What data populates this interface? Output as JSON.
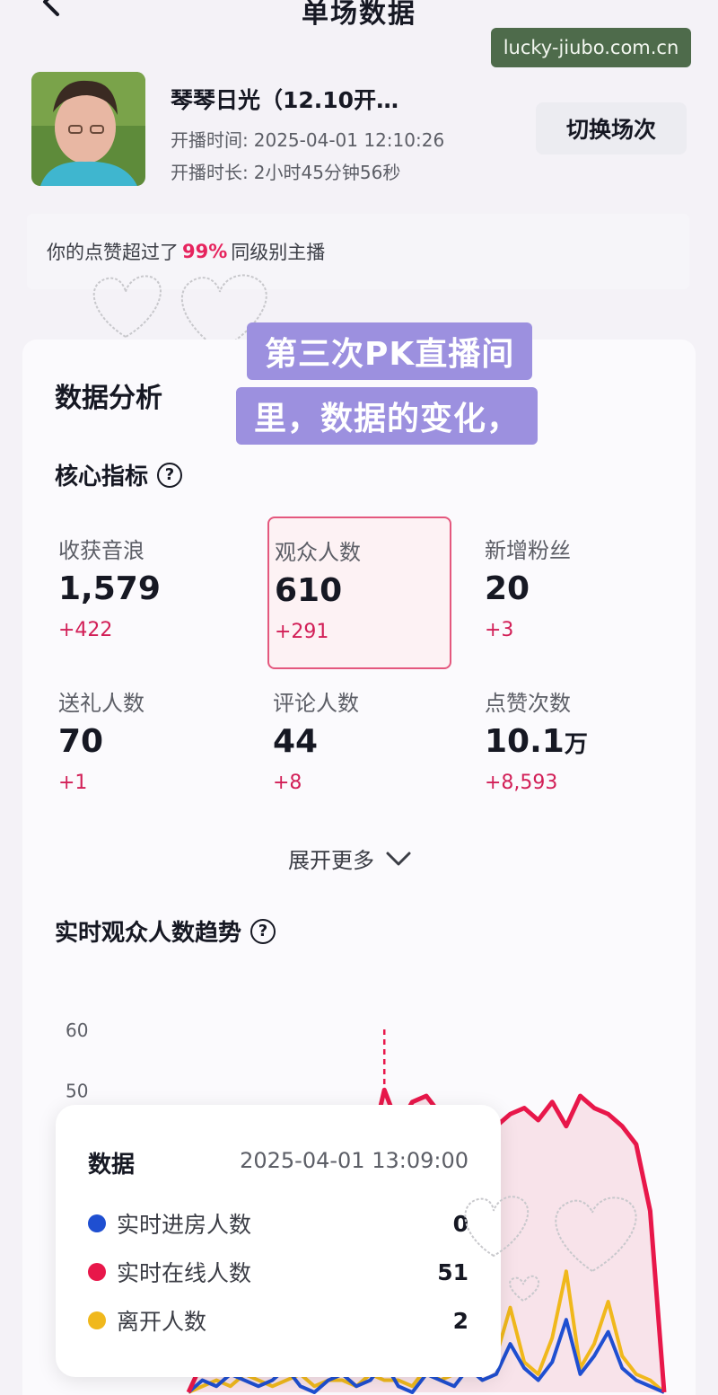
{
  "page": {
    "title": "单场数据",
    "watermark": "lucky-jiubo.com.cn"
  },
  "host": {
    "name": "琴琴日光（12.10开…",
    "start_label": "开播时间:",
    "start_time": "2025-04-01 12:10:26",
    "duration_label": "开播时长:",
    "duration": "2小时45分钟56秒",
    "switch_label": "切换场次"
  },
  "banner": {
    "prefix": "你的点赞超过了",
    "highlight": "99%",
    "suffix": "同级别主播"
  },
  "overlay_caption": {
    "line1": "第三次PK直播间",
    "line2": "里，数据的变化，"
  },
  "analysis": {
    "title": "数据分析",
    "core_title": "核心指标",
    "metrics": [
      {
        "label": "收获音浪",
        "value": "1,579",
        "unit": "",
        "delta": "+422"
      },
      {
        "label": "观众人数",
        "value": "610",
        "unit": "",
        "delta": "+291"
      },
      {
        "label": "新增粉丝",
        "value": "20",
        "unit": "",
        "delta": "+3"
      },
      {
        "label": "送礼人数",
        "value": "70",
        "unit": "",
        "delta": "+1"
      },
      {
        "label": "评论人数",
        "value": "44",
        "unit": "",
        "delta": "+8"
      },
      {
        "label": "点赞次数",
        "value": "10.1",
        "unit": "万",
        "delta": "+8,593"
      }
    ],
    "expand_label": "展开更多",
    "trend_title": "实时观众人数趋势"
  },
  "chart_data": {
    "type": "line",
    "y_ticks": [
      "60",
      "50"
    ],
    "ylim": [
      0,
      60
    ],
    "series": [
      {
        "name": "实时进房人数",
        "color": "#1f4fd1",
        "values": [
          0,
          2,
          1,
          3,
          2,
          1,
          2,
          4,
          1,
          0,
          2,
          3,
          1,
          2,
          5,
          1,
          0,
          3,
          2,
          1,
          4,
          2,
          3,
          8,
          4,
          2,
          5,
          12,
          3,
          6,
          10,
          4,
          2,
          1,
          0
        ]
      },
      {
        "name": "实时在线人数",
        "color": "#e8174a",
        "values": [
          0,
          5,
          8,
          10,
          12,
          14,
          16,
          18,
          22,
          25,
          28,
          30,
          34,
          40,
          50,
          44,
          48,
          49,
          46,
          45,
          47,
          46,
          44,
          46,
          47,
          45,
          48,
          44,
          49,
          47,
          46,
          44,
          41,
          30,
          0
        ]
      },
      {
        "name": "离开人数",
        "color": "#f0b81c",
        "values": [
          0,
          1,
          2,
          1,
          3,
          2,
          1,
          2,
          3,
          1,
          2,
          2,
          1,
          3,
          2,
          2,
          1,
          4,
          2,
          3,
          5,
          3,
          6,
          14,
          5,
          3,
          9,
          20,
          4,
          8,
          15,
          6,
          3,
          2,
          0
        ]
      }
    ],
    "marker_index": 14
  },
  "tooltip": {
    "title": "数据",
    "time": "2025-04-01 13:09:00",
    "rows": [
      {
        "label": "实时进房人数",
        "value": "0",
        "color": "#1f4fd1"
      },
      {
        "label": "实时在线人数",
        "value": "51",
        "color": "#e8174a"
      },
      {
        "label": "离开人数",
        "value": "2",
        "color": "#f0b81c"
      }
    ]
  }
}
